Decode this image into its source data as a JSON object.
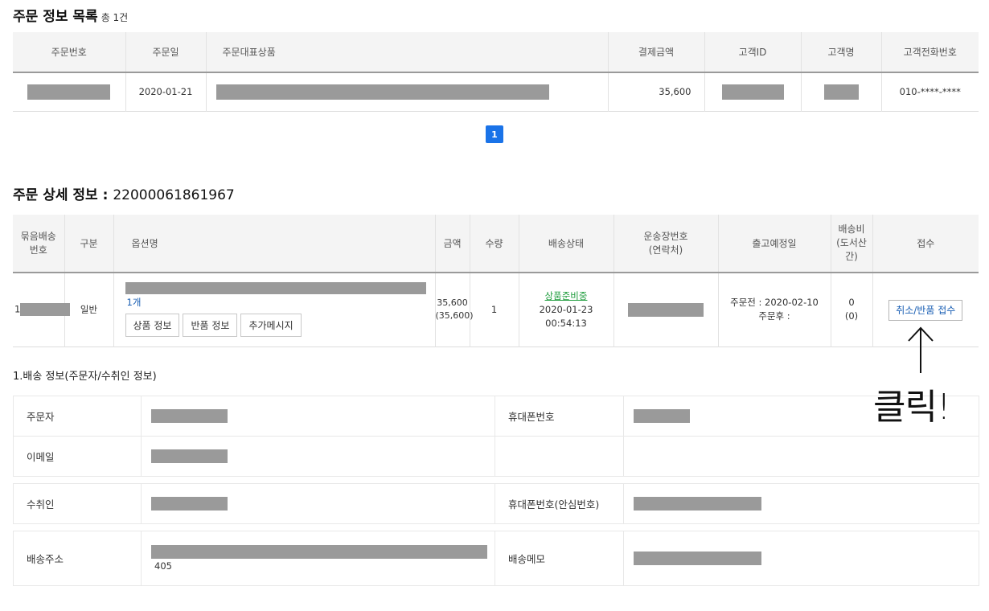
{
  "list": {
    "title": "주문 정보 목록",
    "count": "총 1건",
    "headers": [
      "주문번호",
      "주문일",
      "주문대표상품",
      "결제금액",
      "고객ID",
      "고객명",
      "고객전화번호"
    ],
    "row": {
      "date": "2020-01-21",
      "amount": "35,600",
      "phone": "010-****-****"
    },
    "page": "1"
  },
  "detail": {
    "title": "주문 상세 정보 :",
    "order_number": "22000061861967",
    "headers": {
      "bundle": "묶음배송\n번호",
      "category": "구분",
      "option": "옵션명",
      "price": "금액",
      "qty": "수량",
      "status": "배송상태",
      "tracking": "운송장번호\n(연락처)",
      "ship_date": "출고예정일",
      "ship_fee": "배송비\n(도서산간)",
      "receipt": "접수"
    },
    "row": {
      "bundle_prefix": "1",
      "category": "일반",
      "option_qty": "1개",
      "btn_product_info": "상품 정보",
      "btn_return_info": "반품 정보",
      "btn_extra_msg": "추가메시지",
      "price": "35,600",
      "price_sub": "(35,600)",
      "qty": "1",
      "status": "상품준비중",
      "status_date": "2020-01-23",
      "status_time": "00:54:13",
      "ship_before": "주문전 : 2020-02-10",
      "ship_after": "주문후 :",
      "fee": "0",
      "fee_sub": "(0)",
      "btn_cancel_return": "취소/반품 접수"
    }
  },
  "delivery": {
    "title": "1.배송 정보(주문자/수취인 정보)",
    "orderer_label": "주문자",
    "mobile_label": "휴대폰번호",
    "email_label": "이메일",
    "receiver_label": "수취인",
    "safe_mobile_label": "휴대폰번호(안심번호)",
    "address_label": "배송주소",
    "address_tail": "405",
    "memo_label": "배송메모"
  },
  "annotation": {
    "text": "클릭!"
  }
}
